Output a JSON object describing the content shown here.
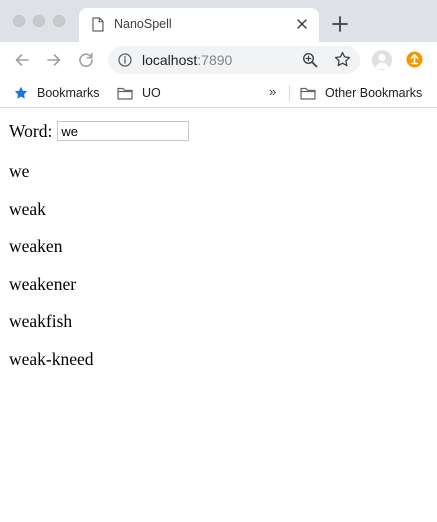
{
  "browser": {
    "tab": {
      "title": "NanoSpell"
    },
    "address": {
      "host": "localhost",
      "port": ":7890"
    },
    "bookmarks_bar": {
      "items": [
        {
          "label": "Bookmarks",
          "icon": "star-icon"
        },
        {
          "label": "UO",
          "icon": "folder-icon"
        }
      ],
      "overflow": "»",
      "other": {
        "label": "Other Bookmarks",
        "icon": "folder-icon"
      }
    },
    "colors": {
      "tabstrip": "#dee1e6",
      "star": "#1a73e8",
      "extension": "#f29900"
    }
  },
  "page": {
    "word_label": "Word:",
    "word_value": "we",
    "suggestions": [
      "we",
      "weak",
      "weaken",
      "weakener",
      "weakfish",
      "weak-kneed"
    ]
  }
}
